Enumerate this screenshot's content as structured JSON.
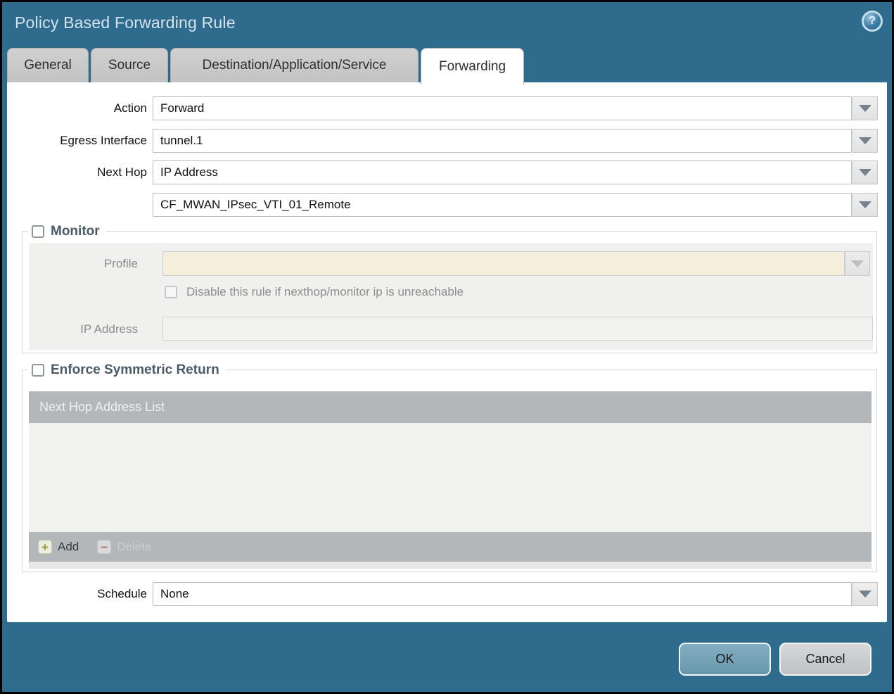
{
  "window": {
    "title": "Policy Based Forwarding Rule",
    "help_icon_glyph": "?"
  },
  "tabs": [
    {
      "label": "General",
      "active": false
    },
    {
      "label": "Source",
      "active": false
    },
    {
      "label": "Destination/Application/Service",
      "active": false
    },
    {
      "label": "Forwarding",
      "active": true
    }
  ],
  "fields": {
    "action": {
      "label": "Action",
      "value": "Forward"
    },
    "egress_interface": {
      "label": "Egress Interface",
      "value": "tunnel.1"
    },
    "next_hop": {
      "label": "Next Hop",
      "value": "IP Address"
    },
    "next_hop_address": {
      "value": "CF_MWAN_IPsec_VTI_01_Remote"
    },
    "schedule": {
      "label": "Schedule",
      "value": "None"
    }
  },
  "monitor": {
    "legend": "Monitor",
    "checked": false,
    "profile": {
      "label": "Profile",
      "value": "",
      "disabled": true
    },
    "disable_rule_checkbox": {
      "label": "Disable this rule if nexthop/monitor ip is unreachable",
      "checked": false,
      "disabled": true
    },
    "ip_address": {
      "label": "IP Address",
      "value": "",
      "disabled": true
    }
  },
  "enforce_symmetric_return": {
    "legend": "Enforce Symmetric Return",
    "checked": false,
    "table": {
      "header": "Next Hop Address List",
      "rows": []
    },
    "add_button": {
      "label": "Add",
      "icon_glyph": "+",
      "enabled": true
    },
    "delete_button": {
      "label": "Delete",
      "icon_glyph": "−",
      "enabled": false
    }
  },
  "footer": {
    "ok_label": "OK",
    "cancel_label": "Cancel"
  },
  "colors": {
    "frame_teal": "#2f6b8d",
    "inactive_tab": "#c9c9c9",
    "disabled_field_beige": "#f5eedd",
    "table_header_gray": "#b3b7b9",
    "ok_button": "#6fa1b5",
    "cancel_button": "#c8cacc",
    "add_icon_green": "#8fa03c",
    "delete_icon_red": "#b37070"
  }
}
